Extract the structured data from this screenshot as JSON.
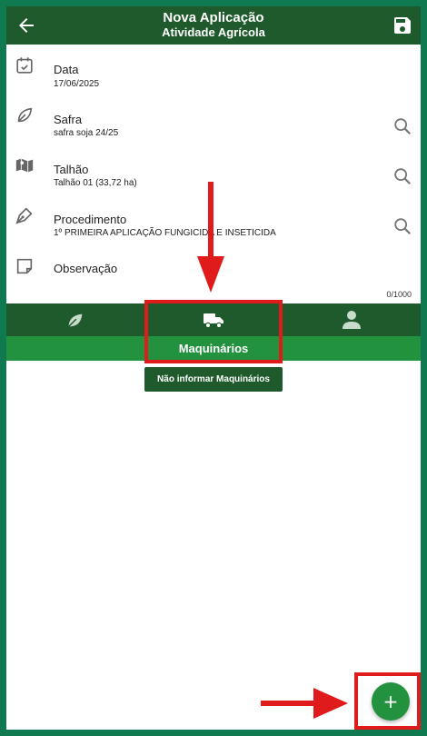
{
  "header": {
    "title": "Nova Aplicação",
    "subtitle": "Atividade Agrícola"
  },
  "form": {
    "date_label": "Data",
    "date_value": "17/06/2025",
    "safra_label": "Safra",
    "safra_value": "safra soja 24/25",
    "talhao_label": "Talhão",
    "talhao_value": "Talhão 01 (33,72 ha)",
    "procedimento_label": "Procedimento",
    "procedimento_value": "1º PRIMEIRA APLICAÇÃO FUNGICIDA E INSETICIDA",
    "observacao_label": "Observação",
    "observacao_counter": "0/1000"
  },
  "tabs": {
    "active_label": "Maquinários",
    "items": [
      "leaf-icon",
      "truck-icon",
      "person-icon"
    ]
  },
  "tooltip": {
    "text": "Não informar Maquinários"
  },
  "fab": {
    "symbol": "+"
  },
  "colors": {
    "header": "#1e5a2b",
    "accent": "#23923f",
    "annotation": "#e01b1b",
    "border": "#0f7a4f"
  }
}
